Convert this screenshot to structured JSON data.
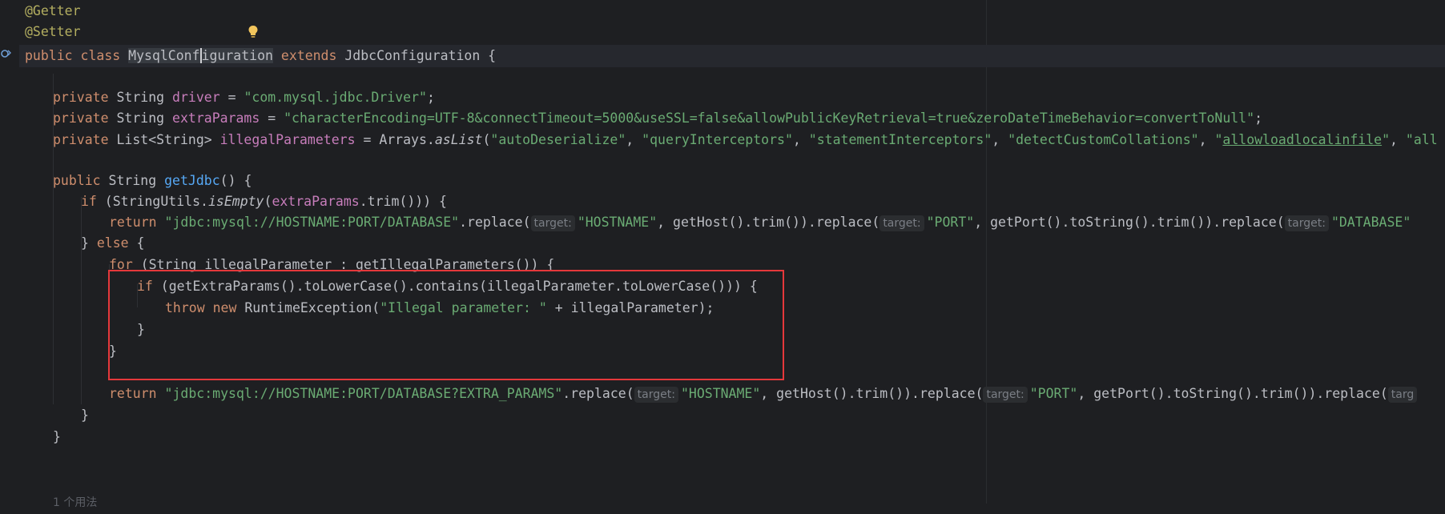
{
  "lines": {
    "l1": "@Getter",
    "l2": "@Setter",
    "l3": {
      "kw1": "public class ",
      "cls1": "MysqlConf",
      "cls2": "iguration",
      "kw2": "extends",
      "rest": " JdbcConfiguration {"
    },
    "l5": {
      "kw": "private",
      "type": " String ",
      "field": "driver",
      "eq": " = ",
      "str": "\"com.mysql.jdbc.Driver\"",
      "end": ";"
    },
    "l6": {
      "kw": "private",
      "type": " String ",
      "field": "extraParams",
      "eq": " = ",
      "str": "\"characterEncoding=UTF-8&connectTimeout=5000&useSSL=false&allowPublicKeyRetrieval=true&zeroDateTimeBehavior=convertToNull\"",
      "end": ";"
    },
    "l7": {
      "kw": "private",
      "type": " List<String> ",
      "field": "illegalParameters",
      "eq": " = Arrays.",
      "method": "asList",
      "open": "(",
      "s1": "\"autoDeserialize\"",
      "c1": ", ",
      "s2": "\"queryInterceptors\"",
      "c2": ", ",
      "s3": "\"statementInterceptors\"",
      "c3": ", ",
      "s4": "\"detectCustomCollations\"",
      "c4": ", ",
      "s5q1": "\"",
      "s5": "allowloadlocalinfile",
      "s5q2": "\"",
      "c5": ", ",
      "s6": "\"all"
    },
    "l9": {
      "kw": "public",
      "type": " String ",
      "fn": "getJdbc",
      "rest": "() {"
    },
    "l10": {
      "kw": "if",
      "p1": " (StringUtils.",
      "method": "isEmpty",
      "p2": "(",
      "field": "extraParams",
      "p3": ".trim())) {"
    },
    "l11": {
      "kw": "return",
      "str": " \"jdbc:mysql://HOSTNAME:PORT/DATABASE\"",
      "r1": ".replace(",
      "hint1": "target:",
      "a1": "\"HOSTNAME\"",
      "r2": ", getHost().trim()).replace(",
      "hint2": "target:",
      "a2": "\"PORT\"",
      "r3": ", getPort().toString().trim()).replace(",
      "hint3": "target:",
      "a3": "\"DATABASE\""
    },
    "l12": {
      "p1": "} ",
      "kw": "else",
      "p2": " {"
    },
    "l13": {
      "kw": "for",
      "rest": " (String illegalParameter : getIllegalParameters()) {"
    },
    "l14": {
      "kw": "if",
      "rest": " (getExtraParams().toLowerCase().contains(illegalParameter.toLowerCase())) {"
    },
    "l15": {
      "kw1": "throw",
      "sp": " ",
      "kw2": "new",
      "p1": " RuntimeException(",
      "str": "\"Illegal parameter: \"",
      "p2": " + illegalParameter);"
    },
    "l16": "}",
    "l17": "}",
    "l19": {
      "kw": "return",
      "str": " \"jdbc:mysql://HOSTNAME:PORT/DATABASE?EXTRA_PARAMS\"",
      "r1": ".replace(",
      "hint1": "target:",
      "a1": "\"HOSTNAME\"",
      "r2": ", getHost().trim()).replace(",
      "hint2": "target:",
      "a2": "\"PORT\"",
      "r3": ", getPort().toString().trim()).replace(",
      "hint3": "targ"
    },
    "l20": "}",
    "l21": "}",
    "l23": "1 个用法"
  },
  "icons": {
    "gutter": "override-marker-icon",
    "bulb": "lightbulb-icon"
  },
  "colors": {
    "highlight_box": "#e5383b",
    "keyword": "#cf8e6d",
    "string": "#6aab73",
    "field": "#c77dbb",
    "function": "#56a8f5",
    "annotation": "#b3ae60"
  }
}
